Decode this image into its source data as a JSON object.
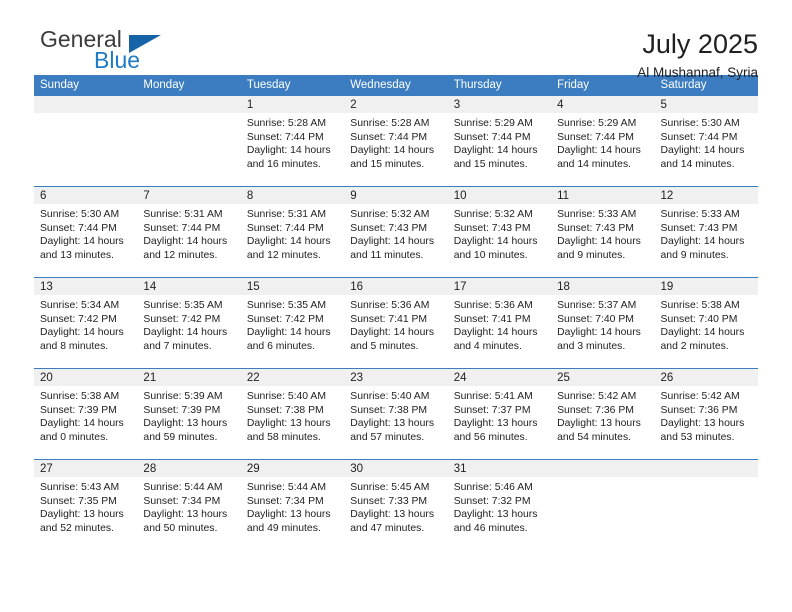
{
  "brand": {
    "name_top": "General",
    "name_bottom": "Blue",
    "color_top": "#3c3c3c",
    "color_bottom": "#1e7bc8",
    "triangle_color": "#1763a8"
  },
  "header": {
    "title": "July 2025",
    "subtitle": "Al Mushannaf, Syria"
  },
  "theme": {
    "header_bg": "#3b7dc0",
    "header_text": "#ffffff",
    "daynum_bg": "#f0f0f0",
    "grid_line": "#3b7dc0",
    "body_text": "#222222"
  },
  "weekday_headers": [
    "Sunday",
    "Monday",
    "Tuesday",
    "Wednesday",
    "Thursday",
    "Friday",
    "Saturday"
  ],
  "labels": {
    "sunrise_prefix": "Sunrise:",
    "sunset_prefix": "Sunset:",
    "daylight_prefix": "Daylight:"
  },
  "weeks": [
    [
      {
        "day": "",
        "blank": true,
        "line1": "",
        "line2": "",
        "line3": "",
        "line4": ""
      },
      {
        "day": "",
        "blank": true,
        "line1": "",
        "line2": "",
        "line3": "",
        "line4": ""
      },
      {
        "day": "1",
        "line1": "Sunrise: 5:28 AM",
        "line2": "Sunset: 7:44 PM",
        "line3": "Daylight: 14 hours",
        "line4": "and 16 minutes."
      },
      {
        "day": "2",
        "line1": "Sunrise: 5:28 AM",
        "line2": "Sunset: 7:44 PM",
        "line3": "Daylight: 14 hours",
        "line4": "and 15 minutes."
      },
      {
        "day": "3",
        "line1": "Sunrise: 5:29 AM",
        "line2": "Sunset: 7:44 PM",
        "line3": "Daylight: 14 hours",
        "line4": "and 15 minutes."
      },
      {
        "day": "4",
        "line1": "Sunrise: 5:29 AM",
        "line2": "Sunset: 7:44 PM",
        "line3": "Daylight: 14 hours",
        "line4": "and 14 minutes."
      },
      {
        "day": "5",
        "line1": "Sunrise: 5:30 AM",
        "line2": "Sunset: 7:44 PM",
        "line3": "Daylight: 14 hours",
        "line4": "and 14 minutes."
      }
    ],
    [
      {
        "day": "6",
        "line1": "Sunrise: 5:30 AM",
        "line2": "Sunset: 7:44 PM",
        "line3": "Daylight: 14 hours",
        "line4": "and 13 minutes."
      },
      {
        "day": "7",
        "line1": "Sunrise: 5:31 AM",
        "line2": "Sunset: 7:44 PM",
        "line3": "Daylight: 14 hours",
        "line4": "and 12 minutes."
      },
      {
        "day": "8",
        "line1": "Sunrise: 5:31 AM",
        "line2": "Sunset: 7:44 PM",
        "line3": "Daylight: 14 hours",
        "line4": "and 12 minutes."
      },
      {
        "day": "9",
        "line1": "Sunrise: 5:32 AM",
        "line2": "Sunset: 7:43 PM",
        "line3": "Daylight: 14 hours",
        "line4": "and 11 minutes."
      },
      {
        "day": "10",
        "line1": "Sunrise: 5:32 AM",
        "line2": "Sunset: 7:43 PM",
        "line3": "Daylight: 14 hours",
        "line4": "and 10 minutes."
      },
      {
        "day": "11",
        "line1": "Sunrise: 5:33 AM",
        "line2": "Sunset: 7:43 PM",
        "line3": "Daylight: 14 hours",
        "line4": "and 9 minutes."
      },
      {
        "day": "12",
        "line1": "Sunrise: 5:33 AM",
        "line2": "Sunset: 7:43 PM",
        "line3": "Daylight: 14 hours",
        "line4": "and 9 minutes."
      }
    ],
    [
      {
        "day": "13",
        "line1": "Sunrise: 5:34 AM",
        "line2": "Sunset: 7:42 PM",
        "line3": "Daylight: 14 hours",
        "line4": "and 8 minutes."
      },
      {
        "day": "14",
        "line1": "Sunrise: 5:35 AM",
        "line2": "Sunset: 7:42 PM",
        "line3": "Daylight: 14 hours",
        "line4": "and 7 minutes."
      },
      {
        "day": "15",
        "line1": "Sunrise: 5:35 AM",
        "line2": "Sunset: 7:42 PM",
        "line3": "Daylight: 14 hours",
        "line4": "and 6 minutes."
      },
      {
        "day": "16",
        "line1": "Sunrise: 5:36 AM",
        "line2": "Sunset: 7:41 PM",
        "line3": "Daylight: 14 hours",
        "line4": "and 5 minutes."
      },
      {
        "day": "17",
        "line1": "Sunrise: 5:36 AM",
        "line2": "Sunset: 7:41 PM",
        "line3": "Daylight: 14 hours",
        "line4": "and 4 minutes."
      },
      {
        "day": "18",
        "line1": "Sunrise: 5:37 AM",
        "line2": "Sunset: 7:40 PM",
        "line3": "Daylight: 14 hours",
        "line4": "and 3 minutes."
      },
      {
        "day": "19",
        "line1": "Sunrise: 5:38 AM",
        "line2": "Sunset: 7:40 PM",
        "line3": "Daylight: 14 hours",
        "line4": "and 2 minutes."
      }
    ],
    [
      {
        "day": "20",
        "line1": "Sunrise: 5:38 AM",
        "line2": "Sunset: 7:39 PM",
        "line3": "Daylight: 14 hours",
        "line4": "and 0 minutes."
      },
      {
        "day": "21",
        "line1": "Sunrise: 5:39 AM",
        "line2": "Sunset: 7:39 PM",
        "line3": "Daylight: 13 hours",
        "line4": "and 59 minutes."
      },
      {
        "day": "22",
        "line1": "Sunrise: 5:40 AM",
        "line2": "Sunset: 7:38 PM",
        "line3": "Daylight: 13 hours",
        "line4": "and 58 minutes."
      },
      {
        "day": "23",
        "line1": "Sunrise: 5:40 AM",
        "line2": "Sunset: 7:38 PM",
        "line3": "Daylight: 13 hours",
        "line4": "and 57 minutes."
      },
      {
        "day": "24",
        "line1": "Sunrise: 5:41 AM",
        "line2": "Sunset: 7:37 PM",
        "line3": "Daylight: 13 hours",
        "line4": "and 56 minutes."
      },
      {
        "day": "25",
        "line1": "Sunrise: 5:42 AM",
        "line2": "Sunset: 7:36 PM",
        "line3": "Daylight: 13 hours",
        "line4": "and 54 minutes."
      },
      {
        "day": "26",
        "line1": "Sunrise: 5:42 AM",
        "line2": "Sunset: 7:36 PM",
        "line3": "Daylight: 13 hours",
        "line4": "and 53 minutes."
      }
    ],
    [
      {
        "day": "27",
        "line1": "Sunrise: 5:43 AM",
        "line2": "Sunset: 7:35 PM",
        "line3": "Daylight: 13 hours",
        "line4": "and 52 minutes."
      },
      {
        "day": "28",
        "line1": "Sunrise: 5:44 AM",
        "line2": "Sunset: 7:34 PM",
        "line3": "Daylight: 13 hours",
        "line4": "and 50 minutes."
      },
      {
        "day": "29",
        "line1": "Sunrise: 5:44 AM",
        "line2": "Sunset: 7:34 PM",
        "line3": "Daylight: 13 hours",
        "line4": "and 49 minutes."
      },
      {
        "day": "30",
        "line1": "Sunrise: 5:45 AM",
        "line2": "Sunset: 7:33 PM",
        "line3": "Daylight: 13 hours",
        "line4": "and 47 minutes."
      },
      {
        "day": "31",
        "line1": "Sunrise: 5:46 AM",
        "line2": "Sunset: 7:32 PM",
        "line3": "Daylight: 13 hours",
        "line4": "and 46 minutes."
      },
      {
        "day": "",
        "blank": true,
        "line1": "",
        "line2": "",
        "line3": "",
        "line4": ""
      },
      {
        "day": "",
        "blank": true,
        "line1": "",
        "line2": "",
        "line3": "",
        "line4": ""
      }
    ]
  ]
}
